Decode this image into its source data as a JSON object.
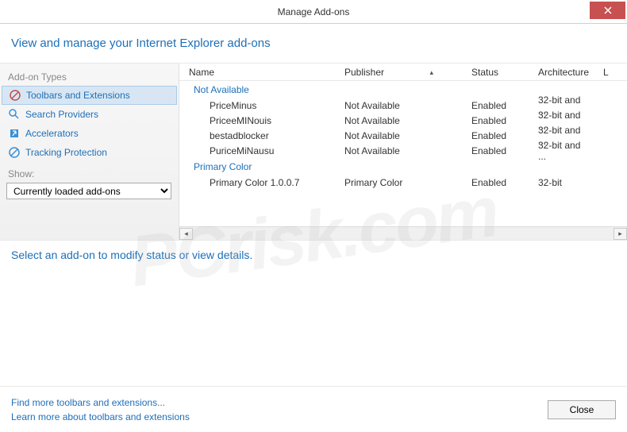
{
  "window": {
    "title": "Manage Add-ons"
  },
  "header": {
    "banner": "View and manage your Internet Explorer add-ons"
  },
  "sidebar": {
    "heading": "Add-on Types",
    "items": [
      {
        "label": "Toolbars and Extensions",
        "icon": "toolbar-icon"
      },
      {
        "label": "Search Providers",
        "icon": "search-icon"
      },
      {
        "label": "Accelerators",
        "icon": "accelerator-icon"
      },
      {
        "label": "Tracking Protection",
        "icon": "tracking-icon"
      }
    ],
    "show_label": "Show:",
    "show_value": "Currently loaded add-ons"
  },
  "table": {
    "columns": {
      "name": "Name",
      "publisher": "Publisher",
      "status": "Status",
      "architecture": "Architecture",
      "last": "L"
    },
    "groups": [
      {
        "label": "Not Available",
        "rows": [
          {
            "name": "PriceMinus",
            "publisher": "Not Available",
            "status": "Enabled",
            "architecture": "32-bit and ..."
          },
          {
            "name": "PriceeMINouis",
            "publisher": "Not Available",
            "status": "Enabled",
            "architecture": "32-bit and ..."
          },
          {
            "name": "bestadblocker",
            "publisher": "Not Available",
            "status": "Enabled",
            "architecture": "32-bit and ..."
          },
          {
            "name": "PuriceMiNausu",
            "publisher": "Not Available",
            "status": "Enabled",
            "architecture": "32-bit and ..."
          }
        ]
      },
      {
        "label": "Primary Color",
        "rows": [
          {
            "name": "Primary Color 1.0.0.7",
            "publisher": "Primary Color",
            "status": "Enabled",
            "architecture": "32-bit"
          }
        ]
      }
    ]
  },
  "details": {
    "prompt": "Select an add-on to modify status or view details."
  },
  "footer": {
    "link1": "Find more toolbars and extensions...",
    "link2": "Learn more about toolbars and extensions",
    "close": "Close"
  },
  "watermark": "PCrisk.com"
}
